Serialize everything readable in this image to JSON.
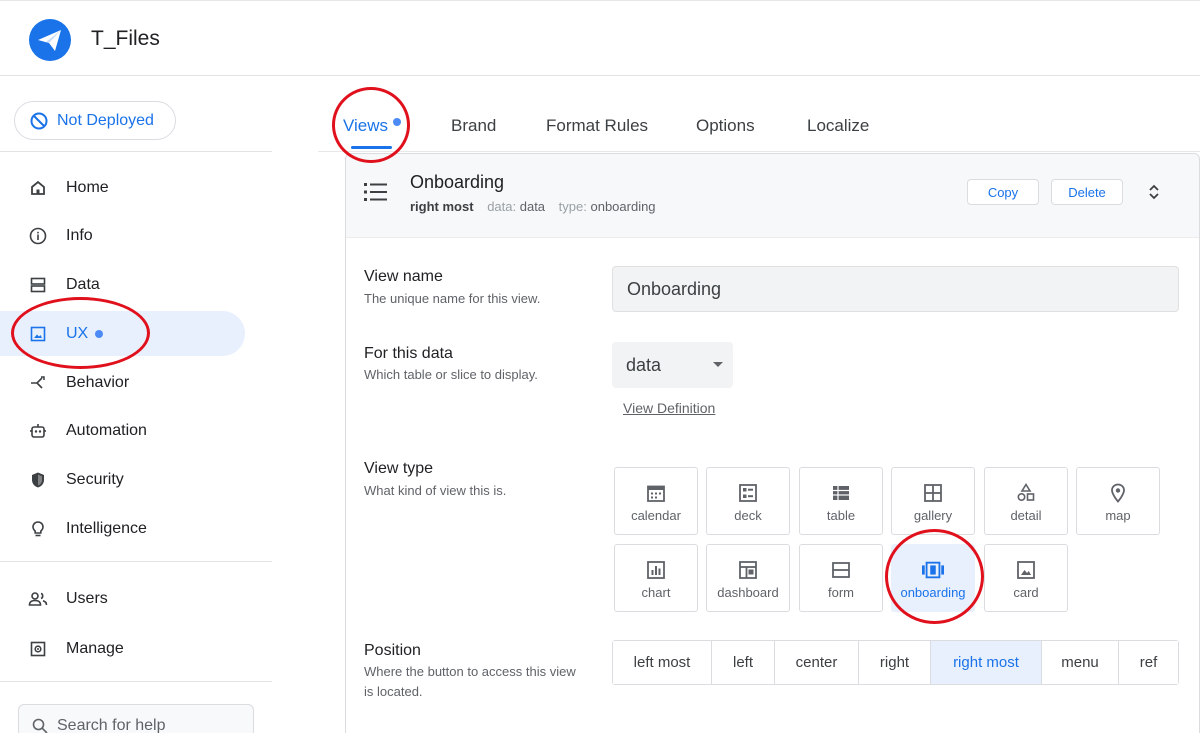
{
  "app": {
    "title": "T_Files"
  },
  "deploy": {
    "label": "Not Deployed"
  },
  "sidebar": {
    "items": [
      {
        "label": "Home"
      },
      {
        "label": "Info"
      },
      {
        "label": "Data"
      },
      {
        "label": "UX"
      },
      {
        "label": "Behavior"
      },
      {
        "label": "Automation"
      },
      {
        "label": "Security"
      },
      {
        "label": "Intelligence"
      },
      {
        "label": "Users"
      },
      {
        "label": "Manage"
      }
    ],
    "search_placeholder": "Search for help"
  },
  "tabs": [
    {
      "label": "Views"
    },
    {
      "label": "Brand"
    },
    {
      "label": "Format Rules"
    },
    {
      "label": "Options"
    },
    {
      "label": "Localize"
    }
  ],
  "view": {
    "title": "Onboarding",
    "position": "right most",
    "data_key": "data:",
    "data_value": "data",
    "type_key": "type:",
    "type_value": "onboarding",
    "copy_label": "Copy",
    "delete_label": "Delete"
  },
  "form": {
    "view_name_label": "View name",
    "view_name_help": "The unique name for this view.",
    "view_name_value": "Onboarding",
    "data_label": "For this data",
    "data_help": "Which table or slice to display.",
    "data_value": "data",
    "view_definition_link": "View Definition",
    "view_type_label": "View type",
    "view_type_help": "What kind of view this is.",
    "view_types": [
      "calendar",
      "deck",
      "table",
      "gallery",
      "detail",
      "map",
      "chart",
      "dashboard",
      "form",
      "onboarding",
      "card"
    ],
    "position_label": "Position",
    "position_help": "Where the button to access this view is located.",
    "positions": [
      "left most",
      "left",
      "center",
      "right",
      "right most",
      "menu",
      "ref"
    ]
  },
  "colors": {
    "accent": "#1a73e8",
    "selected_bg": "#e8f0fe",
    "annotation": "#e0111c"
  }
}
